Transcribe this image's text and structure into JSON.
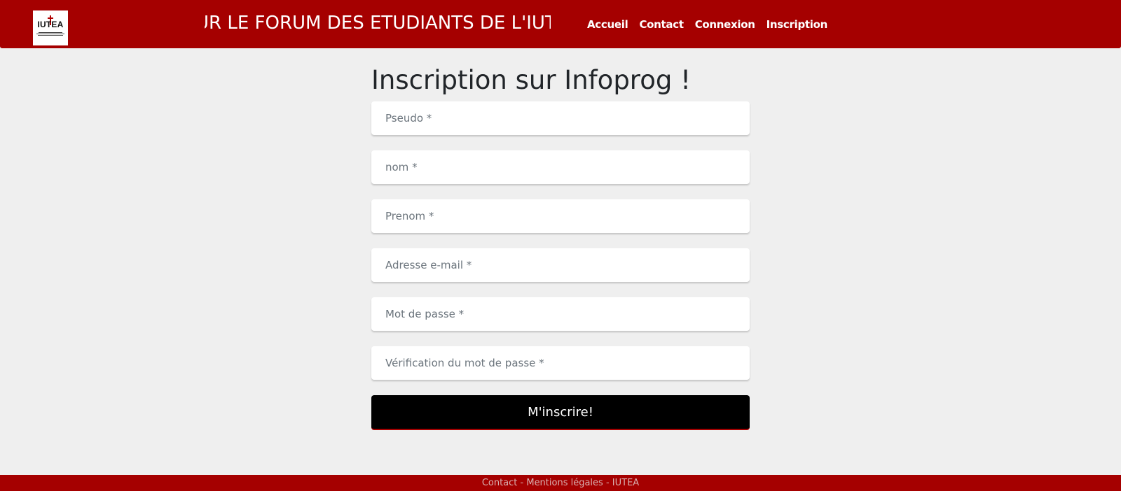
{
  "header": {
    "logo_text": "IUTEA",
    "marquee_text": "UR LE FORUM DES ETUDIANTS DE L'IUTEA",
    "nav": [
      {
        "label": "Accueil"
      },
      {
        "label": "Contact"
      },
      {
        "label": "Connexion"
      },
      {
        "label": "Inscription"
      }
    ]
  },
  "form": {
    "title": "Inscription sur Infoprog !",
    "fields": [
      {
        "placeholder": "Pseudo *",
        "value": ""
      },
      {
        "placeholder": "nom *",
        "value": ""
      },
      {
        "placeholder": "Prenom *",
        "value": ""
      },
      {
        "placeholder": "Adresse e-mail *",
        "value": ""
      },
      {
        "placeholder": "Mot de passe *",
        "value": ""
      },
      {
        "placeholder": "Vérification du mot de passe *",
        "value": ""
      }
    ],
    "submit_label": "M'inscrire!"
  },
  "footer": {
    "text": "Contact - Mentions légales - IUTEA"
  },
  "colors": {
    "brand_red": "#a50000",
    "page_background": "#efefef",
    "button": "#000000"
  }
}
